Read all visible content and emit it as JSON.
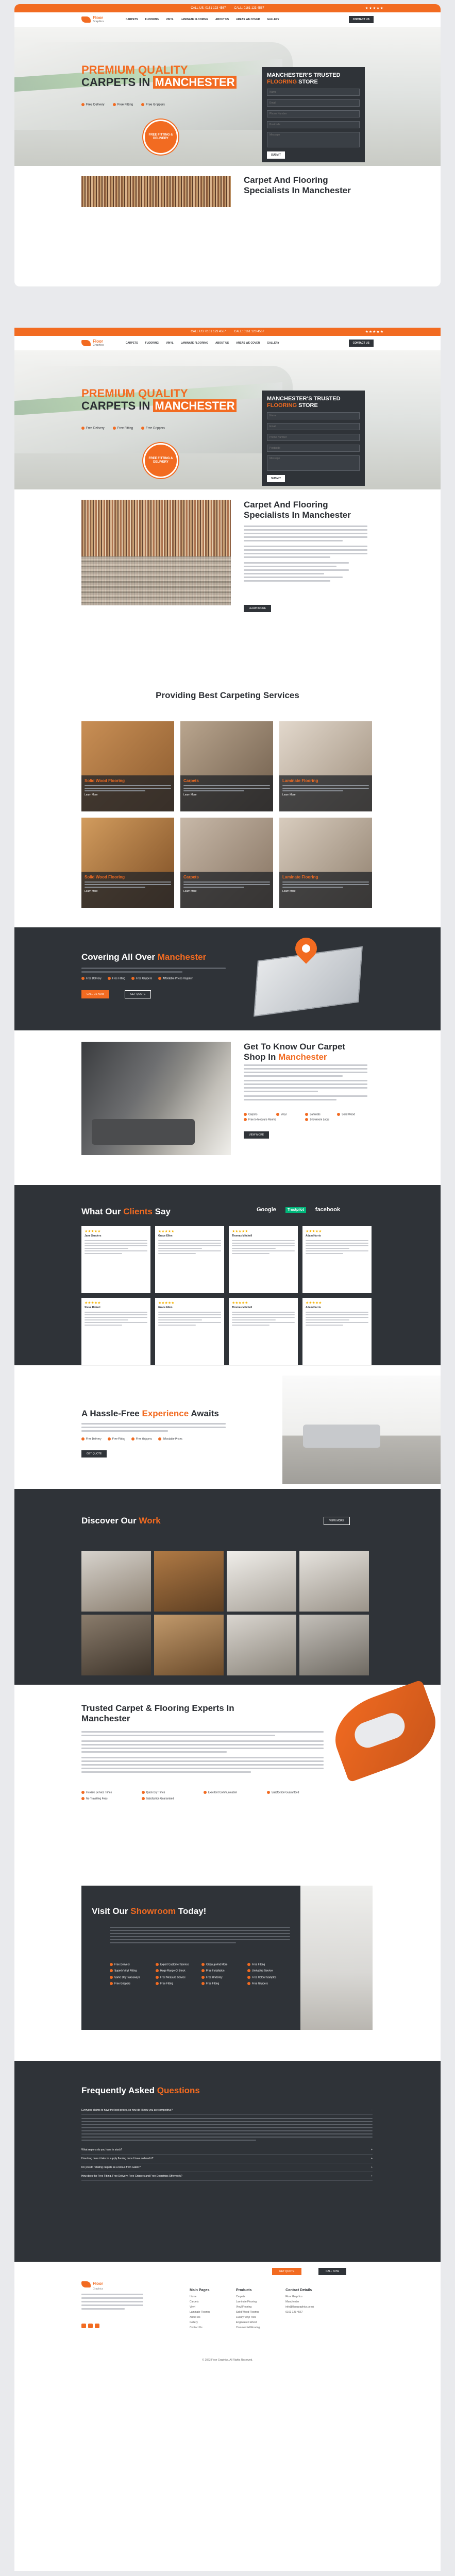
{
  "topbar": {
    "phone1": "CALL US: 0161 123 4567",
    "phone2": "CALL: 0161 123 4567",
    "stars": "★★★★★"
  },
  "nav": {
    "logo_name": "Floor",
    "logo_sub": "Graphics",
    "items": [
      "CARPETS",
      "FLOORING",
      "VINYL",
      "LAMINATE FLOORING",
      "ABOUT US",
      "AREAS WE COVER",
      "GALLERY"
    ],
    "contact": "CONTACT US"
  },
  "hero": {
    "line1": "PREMIUM QUALITY",
    "line2a": "CARPETS",
    "line2b": "IN",
    "line2c": "MANCHESTER",
    "checks": [
      "Free Delivery",
      "Free Fitting",
      "Free Grippers"
    ],
    "badge": "FREE FITTING & DELIVERY"
  },
  "form": {
    "title1": "MANCHESTER'S TRUSTED",
    "title2": "FLOORING",
    "title3": "STORE",
    "fields": [
      "Name",
      "Email",
      "Phone Number",
      "Postcode",
      "Message"
    ],
    "submit": "SUBMIT"
  },
  "about": {
    "heading": "Carpet And Flooring Specialists In Manchester",
    "button": "LEARN MORE"
  },
  "services": {
    "heading": "Providing Best Carpeting Services",
    "items": [
      {
        "title": "Solid Wood Flooring",
        "more": "Learn More"
      },
      {
        "title": "Carpets",
        "more": "Learn More"
      },
      {
        "title": "Laminate Flooring",
        "more": "Learn More"
      },
      {
        "title": "Solid Wood Flooring",
        "more": "Learn More"
      },
      {
        "title": "Carpets",
        "more": "Learn More"
      },
      {
        "title": "Laminate Flooring",
        "more": "Learn More"
      }
    ]
  },
  "covering": {
    "heading1": "Covering All Over",
    "heading2": "Manchester",
    "checks": [
      "Free Delivery",
      "Free Fitting",
      "Free Grippers",
      "Affordable Prices Register"
    ],
    "btn1": "CALL US NOW",
    "btn2": "GET QUOTE"
  },
  "shop": {
    "heading1": "Get To Know Our Carpet Shop In",
    "heading2": "Manchester",
    "tags": [
      "Carpets",
      "Vinyl",
      "Laminate",
      "Solid Wood",
      "Free to Measure Rooms",
      "Showroom Local"
    ],
    "button": "VIEW MORE"
  },
  "reviews": {
    "heading1": "What Our",
    "heading2": "Clients",
    "heading3": "Say",
    "logos": [
      "Google",
      "Trustpilot",
      "facebook"
    ],
    "names": [
      "Jane Sanders",
      "Grace Ellen",
      "Thomas Mitchell",
      "Adam Harris",
      "Steve Robert",
      "Grace Ellen",
      "Thomas Mitchell",
      "Adam Harris"
    ],
    "stars": "★★★★★",
    "dots": "● ● ● ●"
  },
  "hassle": {
    "heading1": "A Hassle-Free",
    "heading2": "Experience",
    "heading3": "Awaits",
    "checks": [
      "Free Delivery",
      "Free Fitting",
      "Free Grippers",
      "Affordable Prices"
    ],
    "button": "GET QUOTE"
  },
  "work": {
    "heading1": "Discover Our",
    "heading2": "Work",
    "button": "VIEW MORE"
  },
  "trusted": {
    "heading": "Trusted Carpet & Flooring Experts In Manchester",
    "checks": [
      "Flexible Service Times",
      "Quick Dry Times",
      "Excellent Communication",
      "Satisfaction Guaranteed",
      "No Travelling Fees",
      "Satisfaction Guaranteed"
    ]
  },
  "showroom": {
    "heading1": "Visit Our",
    "heading2": "Showroom",
    "heading3": "Today!",
    "checks": [
      "Free Delivery",
      "Expert Customer Service",
      "Cleanup And More",
      "Free Fitting",
      "Superb Vinyl Fitting",
      "Huge Range Of Stock",
      "Free Installation",
      "Unrivalled Service",
      "Same Day Takeaways",
      "Free Measure Service",
      "Free Underlay",
      "Free Colour Samples",
      "Free Grippers",
      "Free Fitting",
      "Free Fitting",
      "Free Grippers"
    ]
  },
  "faq": {
    "heading1": "Frequently Asked",
    "heading2": "Questions",
    "items": [
      "Everyone claims to have the best prices, so how do I know you are competitive?",
      "What regions do you have in stock?",
      "How long does it take to supply flooring once I have ordered it?",
      "Do you do retailing carpets as a bonus from Gabor?",
      "How does the Free Fitting, Free Delivery, Free Grippers and Free Doorstrips Offer work?"
    ]
  },
  "footer": {
    "btn1": "GET QUOTE",
    "btn2": "CALL NOW",
    "col1_title": "Main Pages",
    "col1": [
      "Home",
      "Carpets",
      "Vinyl",
      "Laminate Flooring",
      "About Us",
      "Gallery",
      "Contact Us"
    ],
    "col2_title": "Products",
    "col2": [
      "Carpets",
      "Laminate Flooring",
      "Vinyl Flooring",
      "Solid Wood Flooring",
      "Luxury Vinyl Tiles",
      "Engineered Wood",
      "Commercial Flooring"
    ],
    "col3_title": "Contact Details",
    "col3": [
      "Floor Graphics",
      "Manchester",
      "info@floorgraphics.co.uk",
      "0161 123 4567"
    ],
    "copyright": "© 2023 Floor Graphics. All Rights Reserved."
  }
}
